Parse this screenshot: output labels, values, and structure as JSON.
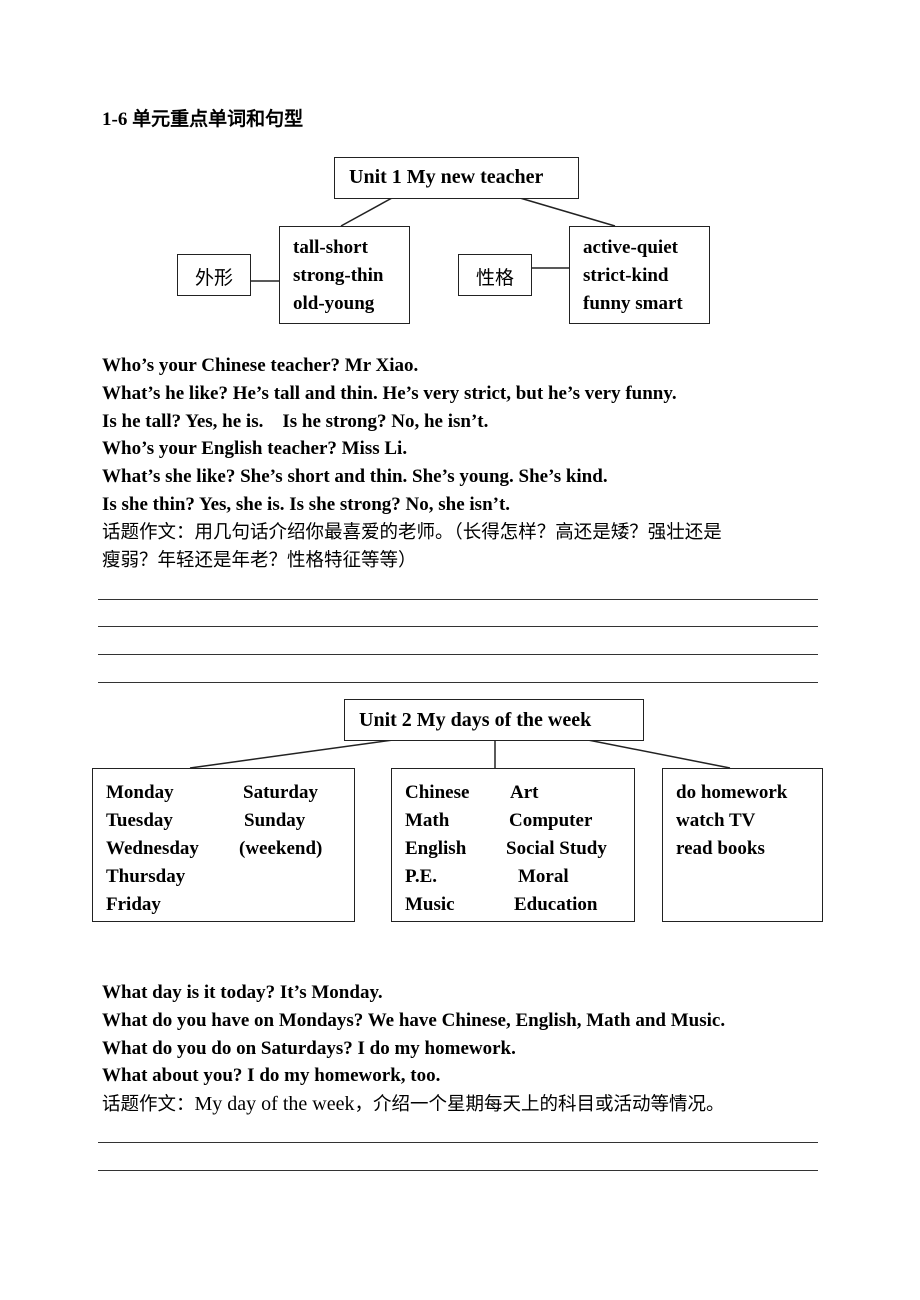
{
  "document_title": "1-6 单元重点单词和句型",
  "unit1": {
    "title": "Unit 1 My new teacher",
    "appearance": {
      "label": "外形",
      "words": [
        "tall-short",
        "strong-thin",
        "old-young"
      ]
    },
    "personality": {
      "label": "性格",
      "words": [
        "active-quiet",
        "strict-kind",
        "funny smart"
      ]
    },
    "sentences": [
      "Who’s your Chinese teacher? Mr Xiao.",
      "What’s he like? He’s tall and thin. He’s very strict, but he’s very funny.",
      "Is he tall? Yes, he is.    Is he strong? No, he isn’t.",
      "Who’s your English teacher? Miss Li.",
      "What’s she like? She’s short and thin. She’s young. She’s kind.",
      "Is she thin? Yes, she is. Is she strong? No, she isn’t."
    ],
    "composition_prompt_line1": "话题作文：用几句话介绍你最喜爱的老师。（长得怎样？高还是矮？强壮还是",
    "composition_prompt_line2": "瘦弱？年轻还是年老？性格特征等等）",
    "answer_lines": 4
  },
  "unit2": {
    "title": "Unit 2 My days of the week",
    "days": {
      "column1": [
        "Monday",
        "Tuesday",
        "Wednesday",
        "Thursday",
        "Friday"
      ],
      "column2": [
        "Saturday",
        "Sunday",
        "(weekend)"
      ]
    },
    "subjects": {
      "column1": [
        "Chinese",
        "Math",
        "English",
        "P.E.",
        "Music"
      ],
      "column2": [
        "Art",
        "Computer",
        "Social Study",
        "Moral",
        "Education"
      ]
    },
    "activities": [
      "do homework",
      "watch TV",
      "read books"
    ],
    "sentences": [
      "What day is it today? It’s Monday.",
      "What do you have on Mondays? We have Chinese, English, Math and Music.",
      "What do you do on Saturdays? I do my homework.",
      "What about you? I do my homework, too."
    ],
    "composition_prompt": {
      "prefix": "话题作文：",
      "english": "My day of the week",
      "suffix": "，介绍一个星期每天上的科目或活动等情况。"
    },
    "answer_lines": 2
  }
}
